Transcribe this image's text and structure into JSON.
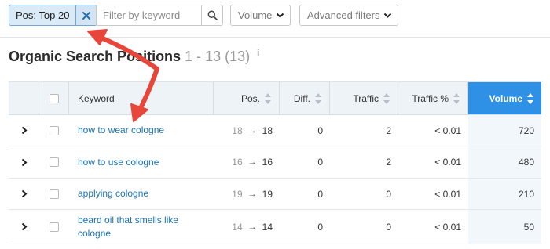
{
  "filters": {
    "chip_label": "Pos: Top 20",
    "search_placeholder": "Filter by keyword",
    "search_value": "",
    "volume_label": "Volume",
    "advanced_label": "Advanced filters"
  },
  "heading": {
    "title": "Organic Search Positions",
    "range": "1 - 13 (13)",
    "info": "i"
  },
  "table": {
    "columns": {
      "keyword": "Keyword",
      "pos": "Pos.",
      "diff": "Diff.",
      "traffic": "Traffic",
      "traffic_pct": "Traffic %",
      "volume": "Volume"
    },
    "rows": [
      {
        "keyword": "how to wear cologne",
        "pos_prev": "18",
        "pos_arrow": "→",
        "pos": "18",
        "diff": "0",
        "traffic": "2",
        "traffic_pct": "< 0.01",
        "volume": "720"
      },
      {
        "keyword": "how to use cologne",
        "pos_prev": "16",
        "pos_arrow": "→",
        "pos": "16",
        "diff": "0",
        "traffic": "2",
        "traffic_pct": "< 0.01",
        "volume": "480"
      },
      {
        "keyword": "applying cologne",
        "pos_prev": "19",
        "pos_arrow": "→",
        "pos": "19",
        "diff": "0",
        "traffic": "0",
        "traffic_pct": "< 0.01",
        "volume": "210"
      },
      {
        "keyword": "beard oil that smells like cologne",
        "pos_prev": "14",
        "pos_arrow": "→",
        "pos": "14",
        "diff": "0",
        "traffic": "0",
        "traffic_pct": "< 0.01",
        "volume": "50"
      }
    ]
  },
  "colors": {
    "accent": "#2e91e5",
    "link": "#1a73b8",
    "annotation": "#e8463a",
    "chip_bg": "#dbeaf7"
  },
  "icons": {
    "chip_close": "close-icon",
    "search": "search-icon",
    "dropdown": "chevron-down-icon",
    "expand": "chevron-right-icon",
    "sort": "sort-icon",
    "info": "info-icon"
  }
}
